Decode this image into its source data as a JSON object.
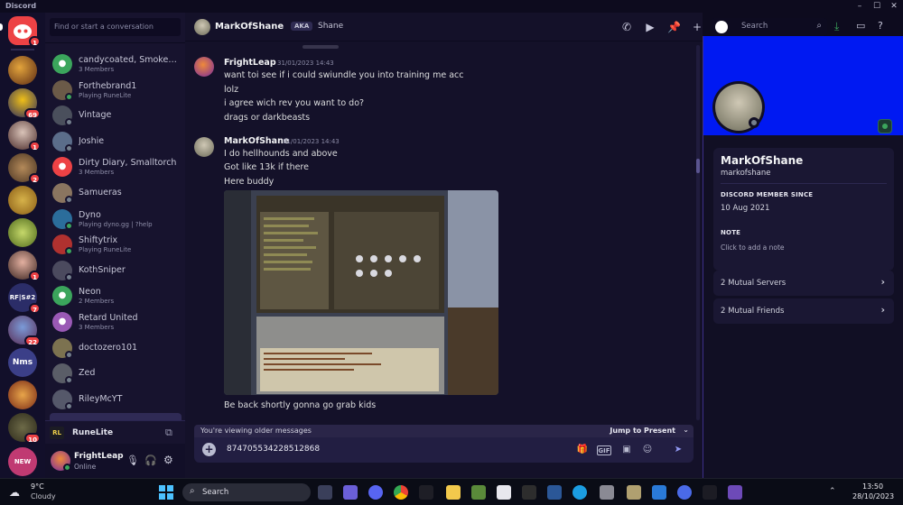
{
  "window": {
    "title": "Discord"
  },
  "servers": [
    {
      "badge": "1"
    },
    {
      "badge": ""
    },
    {
      "badge": "69"
    },
    {
      "badge": "1"
    },
    {
      "badge": "2"
    },
    {
      "badge": ""
    },
    {
      "badge": ""
    },
    {
      "badge": "1"
    },
    {
      "badge": "7",
      "text": "RF|S#2"
    },
    {
      "badge": "22"
    },
    {
      "badge": "",
      "text": "Nms"
    },
    {
      "badge": ""
    },
    {
      "badge": "10"
    },
    {
      "badge": "",
      "text": "NEW"
    }
  ],
  "dm_search": {
    "placeholder": "Find or start a conversation"
  },
  "dms": [
    {
      "name": "candycoated, Smoke…",
      "sub": "3 Members",
      "color": "#3ba55c",
      "group": true
    },
    {
      "name": "Forthebrand1",
      "sub": "Playing RuneLite",
      "color": "#6b5a48"
    },
    {
      "name": "Vintage",
      "sub": "",
      "color": "#4a4f5c"
    },
    {
      "name": "Joshie",
      "sub": "",
      "color": "#5b6d8a"
    },
    {
      "name": "Dirty Diary, Smalltorch",
      "sub": "3 Members",
      "color": "#ed4245",
      "group": true
    },
    {
      "name": "Samueras",
      "sub": "",
      "color": "#8a7560"
    },
    {
      "name": "Dyno",
      "sub": "Playing dyno.gg | ?help",
      "color": "#2b6d9b"
    },
    {
      "name": "Shiftytrix",
      "sub": "Playing RuneLite",
      "color": "#b0312f"
    },
    {
      "name": "KothSniper",
      "sub": "",
      "color": "#4b4a5e"
    },
    {
      "name": "Neon",
      "sub": "2 Members",
      "color": "#3ba55c",
      "group": true
    },
    {
      "name": "Retard United",
      "sub": "3 Members",
      "color": "#9a59b5",
      "group": true
    },
    {
      "name": "doctozero101",
      "sub": "",
      "color": "#7c7250"
    },
    {
      "name": "Zed",
      "sub": "",
      "color": "#5a5d67"
    },
    {
      "name": "RileyMcYT",
      "sub": "",
      "color": "#55586a"
    }
  ],
  "activity": {
    "label": "RuneLite"
  },
  "user": {
    "name": "FrightLeap",
    "status": "Online"
  },
  "chat_header": {
    "name": "MarkOfShane",
    "aka_label": "AKA",
    "aka_name": "Shane",
    "search_placeholder": "Search"
  },
  "messages": [
    {
      "author": "FrightLeap",
      "time": "31/01/2023 14:43",
      "lines": [
        "want toi see if i could swiundle you into training me acc",
        "lolz",
        "i agree wich rev you want to do?",
        "drags or darkbeasts"
      ]
    },
    {
      "author": "MarkOfShane",
      "time": "31/01/2023 14:43",
      "lines": [
        "I do hellhounds and above",
        "Got like 13k if there",
        "Here buddy"
      ],
      "after": "Be back shortly gonna go grab kids"
    }
  ],
  "older_bar": {
    "text": "You're viewing older messages",
    "jump": "Jump to Present"
  },
  "composer": {
    "value": "874705534228512868"
  },
  "profile": {
    "display_name": "MarkOfShane",
    "username": "markofshane",
    "member_since_label": "DISCORD MEMBER SINCE",
    "member_since": "10 Aug 2021",
    "note_label": "NOTE",
    "note_placeholder": "Click to add a note",
    "mutual_servers": "2 Mutual Servers",
    "mutual_friends": "2 Mutual Friends",
    "banner_color": "#0019f2"
  },
  "taskbar": {
    "temp": "9°C",
    "weather": "Cloudy",
    "search": "Search",
    "time": "13:50",
    "date": "28/10/2023"
  }
}
